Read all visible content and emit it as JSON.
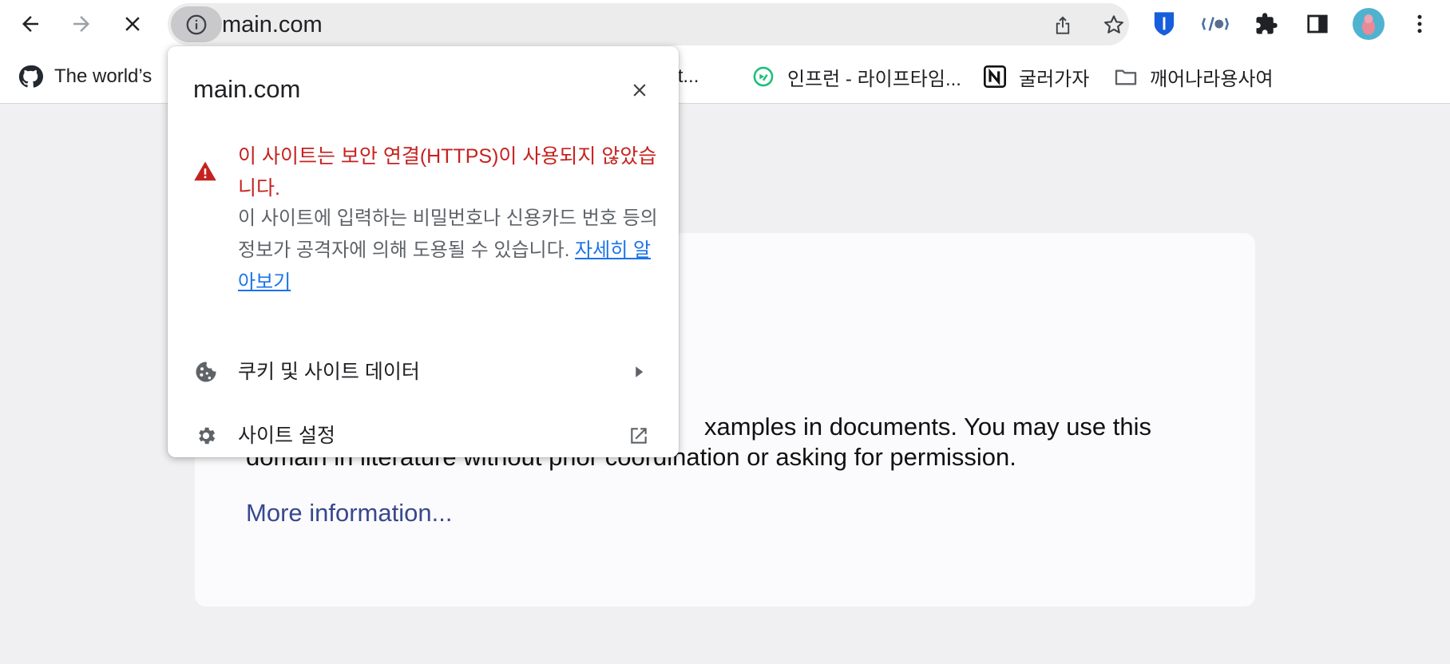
{
  "toolbar": {
    "back_icon": "arrow-left-icon",
    "forward_icon": "arrow-right-icon",
    "stop_icon": "close-icon",
    "url": "main.com",
    "site_info_icon": "info-icon",
    "share_icon": "share-icon",
    "bookmark_icon": "star-icon",
    "extensions": [
      "bitwarden-icon",
      "code-extension-icon",
      "puzzle-icon",
      "sidepanel-icon"
    ],
    "profile_icon": "avatar",
    "menu_icon": "kebab-menu-icon"
  },
  "bookmarks": [
    {
      "label": "The world’s",
      "icon": "github-icon"
    },
    {
      "label": "port...",
      "icon": ""
    },
    {
      "label": "인프런 - 라이프타임...",
      "icon": "inflearn-icon"
    },
    {
      "label": "굴러가자",
      "icon": "notion-icon"
    },
    {
      "label": "깨어나라용사여",
      "icon": "folder-icon"
    }
  ],
  "page": {
    "body_line1": "xamples in documents. You may use this",
    "body_line2": "domain in literature without prior coordination or asking for permission.",
    "more_link": "More information..."
  },
  "popup": {
    "title": "main.com",
    "close_icon": "close-icon",
    "warning_title": "이 사이트는 보안 연결(HTTPS)이 사용되지 않았습니다.",
    "warning_desc": "이 사이트에 입력하는 비밀번호나 신용카드 번호 등의 정보가 공격자에 의해 도용될 수 있습니다.",
    "learn_more": "자세히 알아보기",
    "cookies_label": "쿠키 및 사이트 데이터",
    "site_settings_label": "사이트 설정"
  },
  "colors": {
    "warning": "#c5221f",
    "link": "#1a73e8",
    "page_link": "#38488f"
  }
}
